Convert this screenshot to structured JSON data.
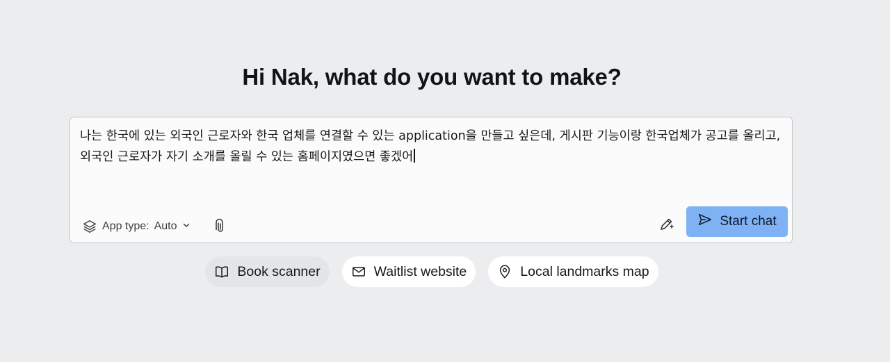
{
  "page": {
    "heading": "Hi Nak, what do you want to make?"
  },
  "composer": {
    "prompt_text": "나는 한국에 있는 외국인 근로자와 한국 업체를 연결할 수 있는 application을 만들고 싶은데, 게시판 기능이랑 한국업체가 공고를 올리고, 외국인 근로자가 자기 소개를 올릴 수 있는 홈페이지였으면 좋겠어",
    "app_type_label": "App type:",
    "app_type_value": "Auto",
    "start_label": "Start chat",
    "icons": {
      "app_type": "layers-icon",
      "dropdown": "chevron-down-icon",
      "attach": "paperclip-icon",
      "enhance": "pen-sparkle-icon",
      "send": "send-icon"
    }
  },
  "suggestions": [
    {
      "label": "Book scanner",
      "icon": "book-open-icon"
    },
    {
      "label": "Waitlist website",
      "icon": "mail-icon"
    },
    {
      "label": "Local landmarks map",
      "icon": "map-pin-icon"
    }
  ],
  "colors": {
    "background": "#ecedef",
    "accent_button": "#7fb2f5",
    "chip_background": "#ffffff"
  }
}
